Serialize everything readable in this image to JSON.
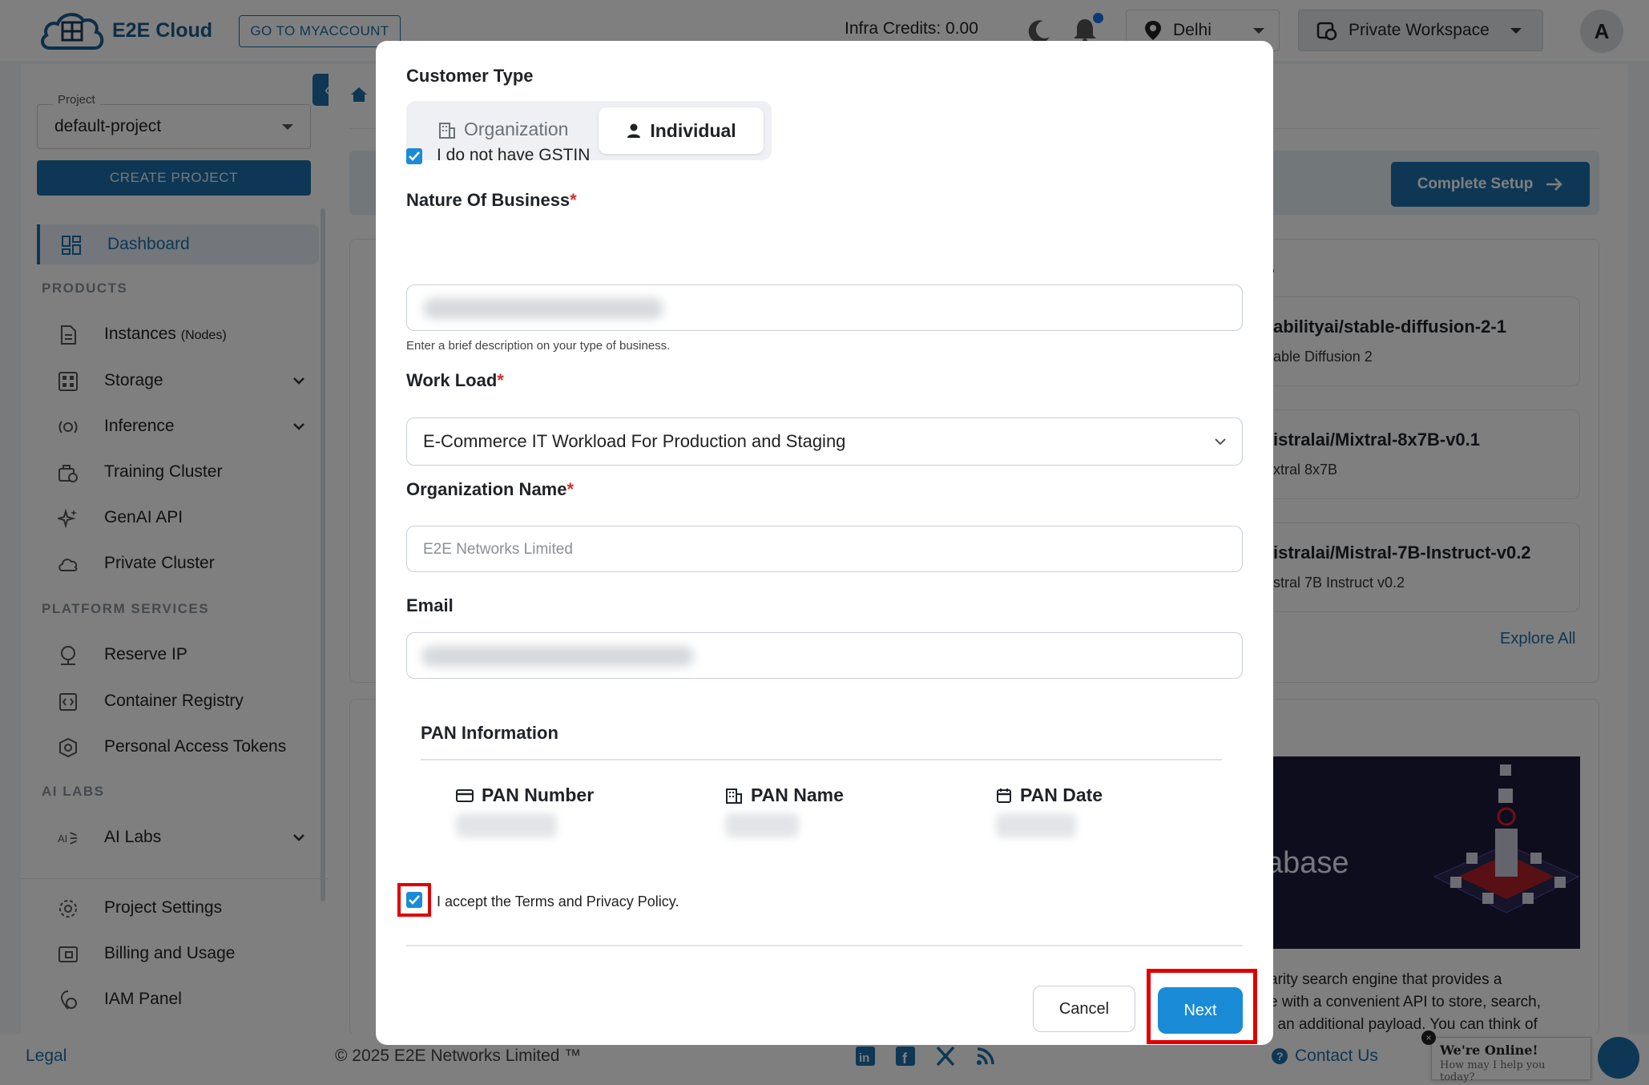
{
  "topbar": {
    "logo_text": "E2E Cloud",
    "logo_sub": "E2E Cloud",
    "myaccount_label": "GO TO MYACCOUNT",
    "infra_credits": "Infra Credits:  0.00",
    "region": "Delhi",
    "workspace": "Private Workspace",
    "avatar_letter": "A"
  },
  "sidebar": {
    "project_legend": "Project",
    "project_value": "default-project",
    "create_label": "CREATE PROJECT",
    "dashboard": "Dashboard",
    "products_heading": "PRODUCTS",
    "instances": "Instances",
    "instances_suffix": "(Nodes)",
    "storage": "Storage",
    "inference": "Inference",
    "training_cluster": "Training Cluster",
    "genai_api": "GenAI API",
    "private_cluster": "Private Cluster",
    "platform_heading": "PLATFORM SERVICES",
    "reserve_ip": "Reserve IP",
    "container_registry": "Container Registry",
    "pat": "Personal Access Tokens",
    "ailabs_heading": "AI LABS",
    "ai_labs": "AI Labs",
    "project_settings": "Project Settings",
    "billing": "Billing and Usage",
    "iam": "IAM Panel"
  },
  "main": {
    "complete_setup": "Complete Setup",
    "card1_heading_fragment": "s",
    "models": [
      {
        "title": "abilityai/stable-diffusion-2-1",
        "sub": "able Diffusion 2"
      },
      {
        "title": "istralai/Mixtral-8x7B-v0.1",
        "sub": "xtral 8x7B"
      },
      {
        "title": "istralai/Mistral-7B-Instruct-v0.2",
        "sub": "stral 7B Instruct v0.2"
      }
    ],
    "explore_all": "Explore All",
    "card2_image_text": "abase",
    "card2_lines": [
      "arity search engine that provides a",
      "e with a convenient API to store, search,",
      ", an additional payload. You can think of"
    ]
  },
  "footer": {
    "legal": "Legal",
    "copyright": "© 2025 E2E Networks Limited ™",
    "contact": "Contact Us",
    "chat_title": "We're Online!",
    "chat_sub": "How may I help you today?"
  },
  "modal": {
    "customer_type_label": "Customer Type",
    "tab_organization": "Organization",
    "tab_individual": "Individual",
    "gstin_label": "I do not have GSTIN",
    "gstin_checked": true,
    "nature_label": "Nature Of Business",
    "nature_helper": "Enter a brief description on your type of business.",
    "workload_label": "Work Load",
    "workload_value": "E-Commerce IT Workload For Production and Staging",
    "org_name_label": "Organization Name",
    "org_name_placeholder": "E2E Networks Limited",
    "email_label": "Email",
    "pan_title": "PAN Information",
    "pan_number": "PAN Number",
    "pan_name": "PAN Name",
    "pan_date": "PAN Date",
    "terms_label": "I accept the Terms and Privacy Policy.",
    "terms_checked": true,
    "cancel_label": "Cancel",
    "next_label": "Next",
    "required_mark": "*"
  },
  "colors": {
    "brand": "#1a6fa8",
    "checkbox": "#1a8bd6",
    "highlight": "#e00000"
  }
}
